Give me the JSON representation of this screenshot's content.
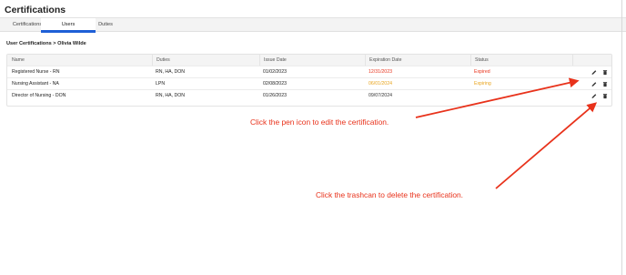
{
  "page": {
    "title": "Certifications"
  },
  "tabs": [
    {
      "label": "Certifications",
      "active": false
    },
    {
      "label": "Users",
      "active": true
    },
    {
      "label": "Duties",
      "active": false
    }
  ],
  "section": {
    "title": "User Certifications > Olivia Wilde"
  },
  "table": {
    "headers": {
      "name": "Name",
      "duties": "Duties",
      "issue_date": "Issue Date",
      "expiration_date": "Expiration Date",
      "status": "Status"
    },
    "rows": [
      {
        "name": "Registered Nurse - RN",
        "duties": "RN, HA, DON",
        "issue_date": "01/02/2023",
        "expiration_date": "12/31/2023",
        "expiration_color": "#e8321b",
        "status": "Expired",
        "status_color": "#e8321b"
      },
      {
        "name": "Nursing Assistant - NA",
        "duties": "LPN",
        "issue_date": "02/08/2023",
        "expiration_date": "06/01/2024",
        "expiration_color": "#e8a31b",
        "status": "Expiring",
        "status_color": "#e8a31b"
      },
      {
        "name": "Director of Nursing - DON",
        "duties": "RN, HA, DON",
        "issue_date": "01/26/2023",
        "expiration_date": "09/07/2024",
        "expiration_color": "#333333",
        "status": "",
        "status_color": "#333333"
      }
    ],
    "row_actions": {
      "edit_icon": "pen-icon",
      "delete_icon": "trashcan-icon"
    }
  },
  "annotations": {
    "edit": "Click the pen icon to edit the certification.",
    "delete": "Click the trashcan to delete the certification.",
    "color": "#e8321b"
  },
  "colors": {
    "accent": "#1e5fd6",
    "expired": "#e8321b",
    "expiring": "#e8a31b"
  }
}
